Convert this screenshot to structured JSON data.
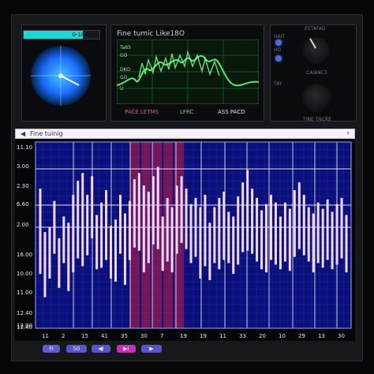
{
  "top": {
    "level_label": "0-10-MM",
    "level_fraction": 0.78,
    "scope_title": "Fine tumic Like18O",
    "scope_labels": [
      "Ta65",
      "GO",
      "DKO",
      "GO",
      "U"
    ],
    "legend": [
      {
        "text": "PACE LETMS",
        "color": "#ff4f6a"
      },
      {
        "text": "LFRC",
        "color": "#48e85f"
      },
      {
        "text": "ASS PACD",
        "color": "#dfe4ea"
      }
    ]
  },
  "controls": {
    "label_left_1": "HAIT",
    "label_left_2": "HO",
    "label_left_3": "TAY",
    "knob1_top": "ESTAFAD",
    "knob1_bottom": "CAIANC3",
    "knob2_bottom": "TINE TNCRE"
  },
  "chart": {
    "title": "Fine tuinig",
    "prev_icon": "triangle-left-icon",
    "next_icon": "chevron-right-icon",
    "y_ticks": [
      "11.10",
      "3.00",
      "2.30",
      "6.60",
      "2.00",
      "16.00",
      "10.00",
      "11.00",
      "12.40",
      "12.40",
      "12.00"
    ],
    "x_ticks": [
      "11",
      "2",
      "15",
      "41",
      "35",
      "30",
      "7",
      "19",
      "19",
      "11",
      "33",
      "20",
      "10",
      "29",
      "13",
      "30"
    ],
    "highlight": "#c81d3c"
  },
  "toolbar": {
    "buttons": [
      "Fi",
      "S0",
      "◀I",
      "▶I",
      "▶"
    ]
  },
  "chart_data": {
    "type": "bar",
    "title": "Fine tuinig",
    "xlabel": "",
    "ylabel": "",
    "ylim": [
      0,
      12
    ],
    "ticks_y": [
      "11.10",
      "3.00",
      "2.30",
      "6.60",
      "2.00",
      "16.00",
      "10.00",
      "11.00",
      "12.40",
      "12.40",
      "12.00"
    ],
    "ticks_x": [
      "11",
      "2",
      "15",
      "41",
      "35",
      "30",
      "7",
      "19",
      "19",
      "11",
      "33",
      "20",
      "10",
      "29",
      "13",
      "30"
    ],
    "bands": [
      [
        3.5,
        9.0
      ],
      [
        2.0,
        6.2
      ],
      [
        3.2,
        6.5
      ],
      [
        4.8,
        8.2
      ],
      [
        2.6,
        5.8
      ],
      [
        4.2,
        7.2
      ],
      [
        2.4,
        6.8
      ],
      [
        3.6,
        8.6
      ],
      [
        4.5,
        9.5
      ],
      [
        4.0,
        10.0
      ],
      [
        4.7,
        8.6
      ],
      [
        5.8,
        9.8
      ],
      [
        3.8,
        7.3
      ],
      [
        3.9,
        8.1
      ],
      [
        4.4,
        8.9
      ],
      [
        3.2,
        6.6
      ],
      [
        3.0,
        7.0
      ],
      [
        4.8,
        8.6
      ],
      [
        2.8,
        7.4
      ],
      [
        4.4,
        8.2
      ],
      [
        5.2,
        9.6
      ],
      [
        5.0,
        10.0
      ],
      [
        3.6,
        9.2
      ],
      [
        4.2,
        8.8
      ],
      [
        5.4,
        9.8
      ],
      [
        5.1,
        10.4
      ],
      [
        3.7,
        7.2
      ],
      [
        4.3,
        8.4
      ],
      [
        3.6,
        7.8
      ],
      [
        4.8,
        9.2
      ],
      [
        5.5,
        9.8
      ],
      [
        5.1,
        9.0
      ],
      [
        4.2,
        8.0
      ],
      [
        4.6,
        8.4
      ],
      [
        3.2,
        7.8
      ],
      [
        4.0,
        8.6
      ],
      [
        3.1,
        6.8
      ],
      [
        4.2,
        7.8
      ],
      [
        3.8,
        8.4
      ],
      [
        4.4,
        8.8
      ],
      [
        4.2,
        7.5
      ],
      [
        3.5,
        7.2
      ],
      [
        4.1,
        8.5
      ],
      [
        4.9,
        9.4
      ],
      [
        5.0,
        10.2
      ],
      [
        4.8,
        9.0
      ],
      [
        4.3,
        8.4
      ],
      [
        3.8,
        7.6
      ],
      [
        3.6,
        8.0
      ],
      [
        4.4,
        8.6
      ],
      [
        4.1,
        8.1
      ],
      [
        3.8,
        7.2
      ],
      [
        4.3,
        8.1
      ],
      [
        3.7,
        7.7
      ],
      [
        4.6,
        8.9
      ],
      [
        5.1,
        9.4
      ],
      [
        4.7,
        8.6
      ],
      [
        4.3,
        7.8
      ],
      [
        3.6,
        7.4
      ],
      [
        4.2,
        8.1
      ],
      [
        3.9,
        7.7
      ],
      [
        4.4,
        8.3
      ],
      [
        3.8,
        7.5
      ],
      [
        4.1,
        8.0
      ],
      [
        4.5,
        8.4
      ],
      [
        3.6,
        7.3
      ]
    ]
  }
}
